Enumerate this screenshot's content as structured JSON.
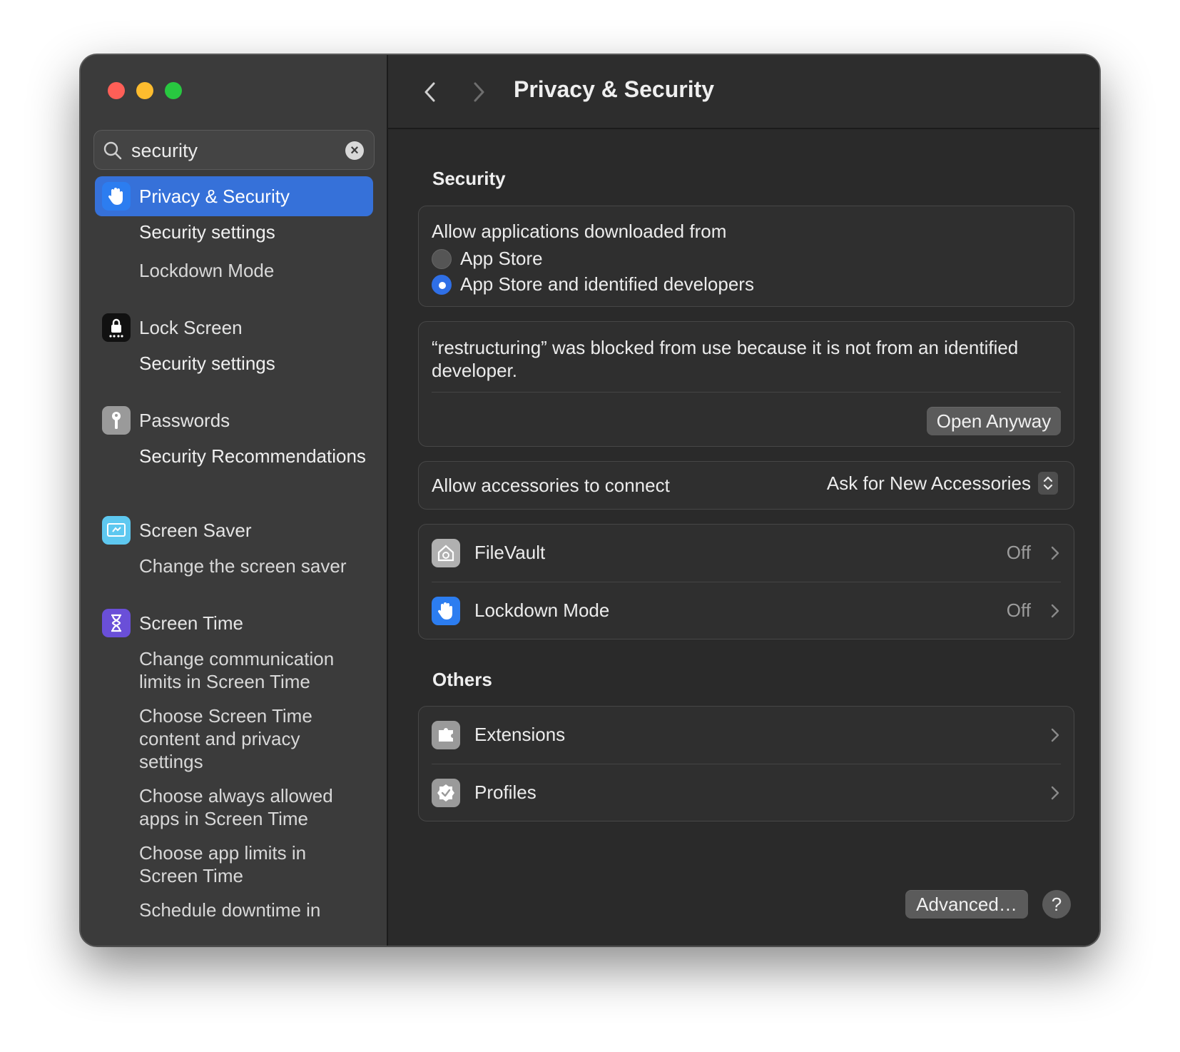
{
  "window": {
    "colors": {
      "close": "#ff5f57",
      "minimize": "#febc2e",
      "zoom": "#28c840",
      "accent": "#3671d9"
    }
  },
  "search": {
    "value": "security",
    "icon": "magnifier-icon",
    "clear_icon": "clear-x-icon"
  },
  "sidebar": {
    "groups": [
      {
        "label": "Privacy & Security",
        "icon": "hand-raised-icon",
        "selected": true,
        "subs": [
          "Security settings",
          "Lockdown Mode"
        ]
      },
      {
        "label": "Lock Screen",
        "icon": "lock-screen-icon",
        "subs": [
          "Security settings"
        ]
      },
      {
        "label": "Passwords",
        "icon": "key-icon",
        "subs": [
          "Security Recommendations"
        ]
      },
      {
        "label": "Screen Saver",
        "icon": "screen-saver-icon",
        "subs": [
          "Change the screen saver"
        ]
      },
      {
        "label": "Screen Time",
        "icon": "hourglass-icon",
        "subs": [
          "Change communication limits in Screen Time",
          "Choose Screen Time content and privacy settings",
          "Choose always allowed apps in Screen Time",
          "Choose app limits in Screen Time",
          "Schedule downtime in"
        ]
      }
    ]
  },
  "toolbar": {
    "title": "Privacy & Security",
    "back_icon": "chevron-left-icon",
    "forward_icon": "chevron-right-icon"
  },
  "security": {
    "heading": "Security",
    "allow_label": "Allow applications downloaded from",
    "options": [
      "App Store",
      "App Store and identified developers"
    ],
    "selected_option": "App Store and identified developers",
    "blocked_message": "“restructuring” was blocked from use because it is not from an identified developer.",
    "open_anyway": "Open Anyway",
    "accessories_label": "Allow accessories to connect",
    "accessories_value": "Ask for New Accessories",
    "rows": [
      {
        "label": "FileVault",
        "value": "Off",
        "icon": "filevault-icon"
      },
      {
        "label": "Lockdown Mode",
        "value": "Off",
        "icon": "hand-raised-icon"
      }
    ]
  },
  "others": {
    "heading": "Others",
    "rows": [
      {
        "label": "Extensions",
        "icon": "puzzle-piece-icon"
      },
      {
        "label": "Profiles",
        "icon": "checkmark-badge-icon"
      }
    ]
  },
  "footer": {
    "advanced": "Advanced…",
    "help": "?"
  }
}
